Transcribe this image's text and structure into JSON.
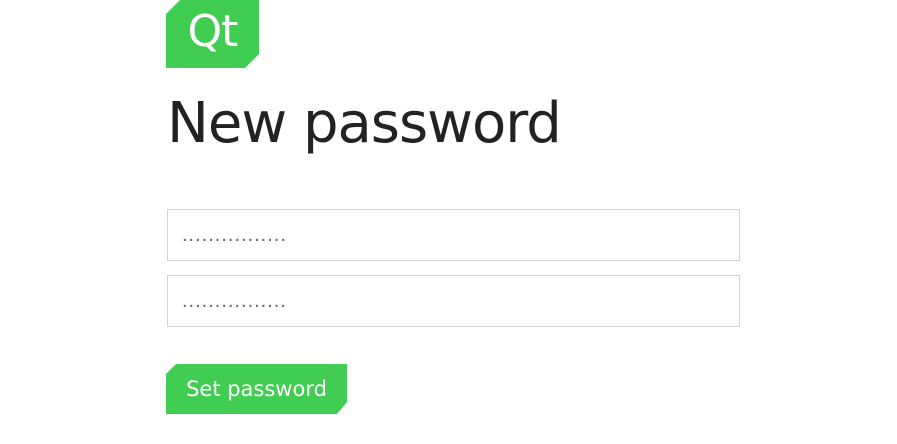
{
  "brand": {
    "logo_text": "Qt",
    "color": "#41cd52"
  },
  "page": {
    "title": "New password"
  },
  "form": {
    "password_value": "................",
    "confirm_value": "................",
    "submit_label": "Set password"
  }
}
